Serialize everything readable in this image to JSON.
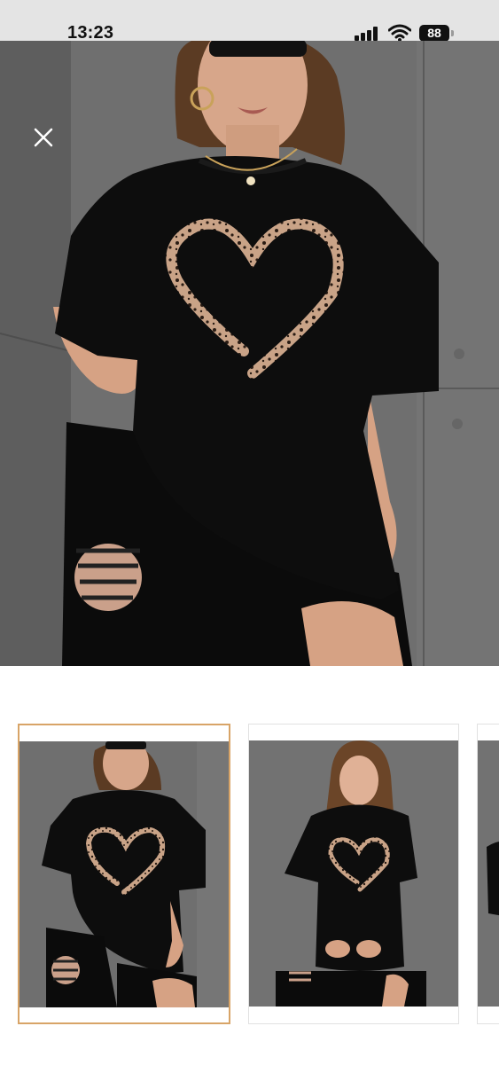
{
  "status_bar": {
    "time": "13:23",
    "battery_level": "88",
    "icons": [
      "signal-icon",
      "wifi-icon",
      "battery-icon"
    ]
  },
  "viewer": {
    "close_icon": "close-icon",
    "selected_index": 1,
    "thumbnail_count": 3
  },
  "colors": {
    "status_bar_bg": "#e4e4e4",
    "selected_border": "#d8a467",
    "shirt": "#0d0d0d",
    "heart_print": "#c9a387"
  }
}
